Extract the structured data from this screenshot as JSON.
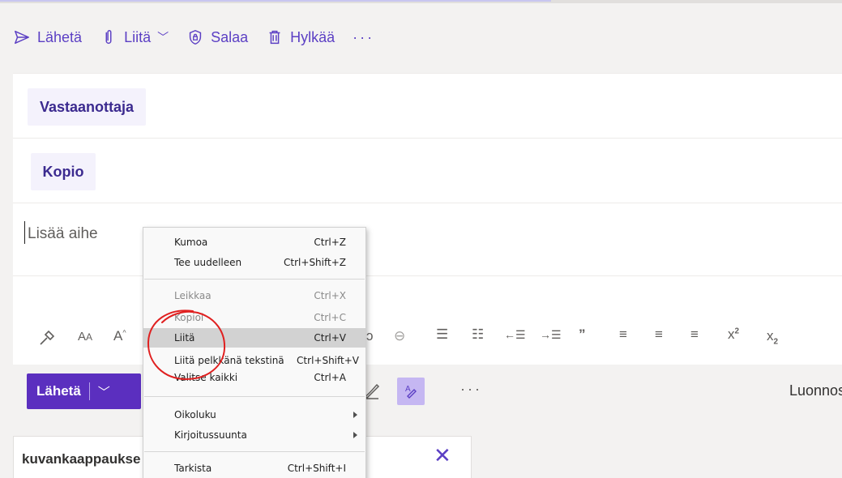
{
  "toolbar": {
    "send": "Lähetä",
    "attach": "Liitä",
    "encrypt": "Salaa",
    "discard": "Hylkää",
    "more": "···"
  },
  "compose": {
    "to_label": "Vastaanottaja",
    "cc_label": "Kopio",
    "subject_placeholder": "Lisää aihe"
  },
  "sendbar": {
    "send_label": "Lähetä",
    "more": "···",
    "draft_status": "Luonnos ta"
  },
  "attachment": {
    "name": "kuvankaappaukse"
  },
  "context_menu": {
    "items": [
      {
        "label": "Kumoa",
        "shortcut": "Ctrl+Z"
      },
      {
        "label": "Tee uudelleen",
        "shortcut": "Ctrl+Shift+Z"
      },
      {
        "label": "Leikkaa",
        "shortcut": "Ctrl+X"
      },
      {
        "label": "Kopioi",
        "shortcut": "Ctrl+C"
      },
      {
        "label": "Liitä",
        "shortcut": "Ctrl+V"
      },
      {
        "label": "Liitä pelkkänä tekstinä",
        "shortcut": "Ctrl+Shift+V"
      },
      {
        "label": "Valitse kaikki",
        "shortcut": "Ctrl+A"
      },
      {
        "label": "Oikoluku",
        "shortcut": ""
      },
      {
        "label": "Kirjoitussuunta",
        "shortcut": ""
      },
      {
        "label": "Tarkista",
        "shortcut": "Ctrl+Shift+I"
      }
    ],
    "highlighted": "Liitä"
  },
  "colors": {
    "accent": "#5b3fc4",
    "send_button": "#5b2fbf",
    "annotation": "#e02020"
  }
}
